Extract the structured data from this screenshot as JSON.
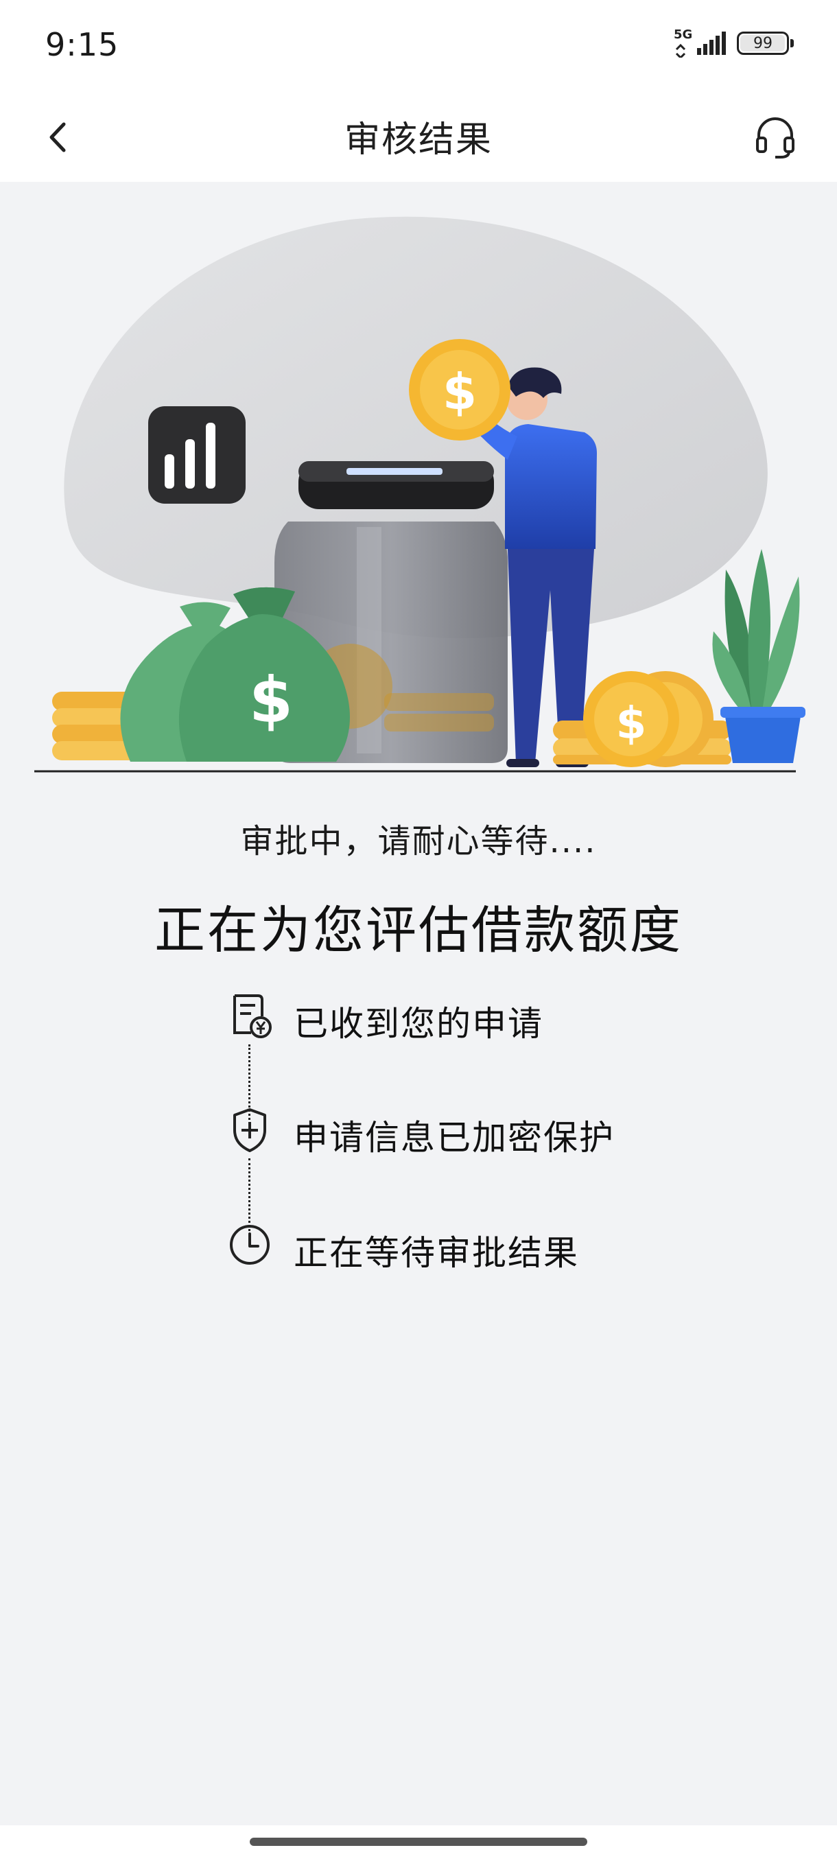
{
  "status_bar": {
    "time": "9:15",
    "network": "5G",
    "battery": "99",
    "battery_level": 0.99
  },
  "nav": {
    "title": "审核结果",
    "back_icon": "chevron-left-icon",
    "support_icon": "headset-icon"
  },
  "illustration": {
    "scene": "savings-jar-illustration",
    "coin_symbol": "$",
    "bag_symbol": "$"
  },
  "status_message": "审批中，请耐心等待....",
  "headline": "正在为您评估借款额度",
  "steps": [
    {
      "label": "已收到您的申请",
      "icon": "receipt-yen-icon"
    },
    {
      "label": "申请信息已加密保护",
      "icon": "shield-plus-icon"
    },
    {
      "label": "正在等待审批结果",
      "icon": "clock-icon"
    }
  ],
  "colors": {
    "page_background": "#f2f3f5",
    "header_background": "#ffffff",
    "coin": "#f5b731",
    "money_bag": "#4fa86e",
    "person": "#2f5fe0",
    "blob": "#d9dadc"
  }
}
